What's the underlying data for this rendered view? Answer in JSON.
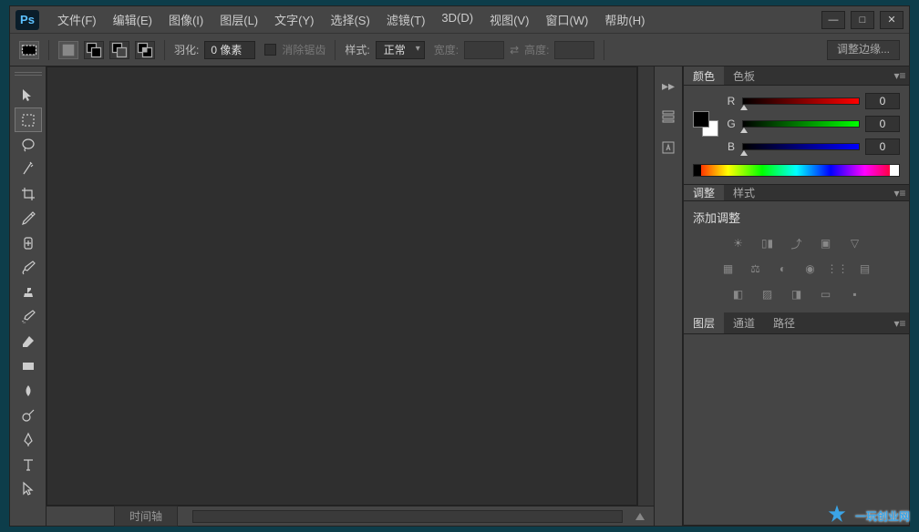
{
  "app": {
    "logo": "Ps"
  },
  "menu": [
    "文件(F)",
    "编辑(E)",
    "图像(I)",
    "图层(L)",
    "文字(Y)",
    "选择(S)",
    "滤镜(T)",
    "3D(D)",
    "视图(V)",
    "窗口(W)",
    "帮助(H)"
  ],
  "winctrl": {
    "min": "—",
    "max": "□",
    "close": "✕"
  },
  "options": {
    "feather_label": "羽化:",
    "feather_value": "0 像素",
    "antialias": "消除锯齿",
    "style_label": "样式:",
    "style_value": "正常",
    "width_label": "宽度:",
    "swap": "⇄",
    "height_label": "高度:",
    "refine_btn": "调整边缘..."
  },
  "dock": {
    "collapse": "▸▸"
  },
  "panels": {
    "color": {
      "tab1": "颜色",
      "tab2": "色板",
      "r_label": "R",
      "g_label": "G",
      "b_label": "B",
      "r": "0",
      "g": "0",
      "b": "0"
    },
    "adjust": {
      "tab1": "调整",
      "tab2": "样式",
      "title": "添加调整"
    },
    "layers": {
      "tab1": "图层",
      "tab2": "通道",
      "tab3": "路径"
    }
  },
  "bottom": {
    "timeline": "时间轴"
  },
  "watermark": {
    "text": "一玩创业网"
  }
}
